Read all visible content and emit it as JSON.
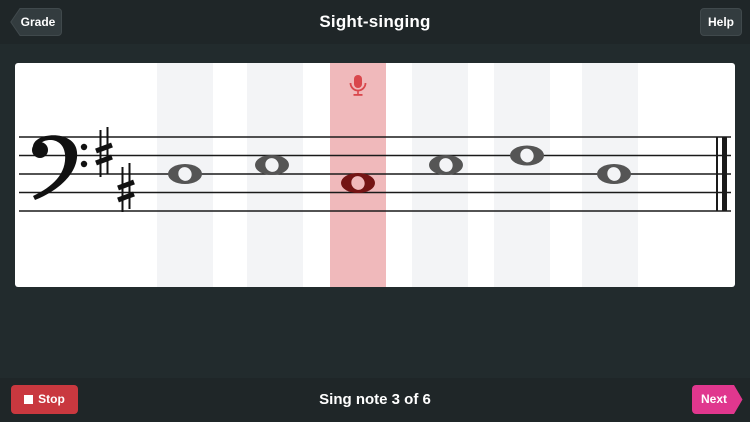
{
  "header": {
    "title": "Sight-singing",
    "back_label": "Grade",
    "help_label": "Help"
  },
  "exercise": {
    "clef": "bass",
    "key_signature": "2 sharps",
    "note_count": 6,
    "current_note": 3,
    "mic_icon": "microphone-icon",
    "colors": {
      "active_column": "#f0b9bb",
      "inactive_column": "#f3f4f6",
      "active_note": "#741414",
      "note": "#555555",
      "mic": "#d9474c"
    }
  },
  "footer": {
    "stop_label": "Stop",
    "status_text": "Sing note 3 of 6",
    "next_label": "Next",
    "stop_color": "#c9383f",
    "next_color": "#e0378e"
  }
}
